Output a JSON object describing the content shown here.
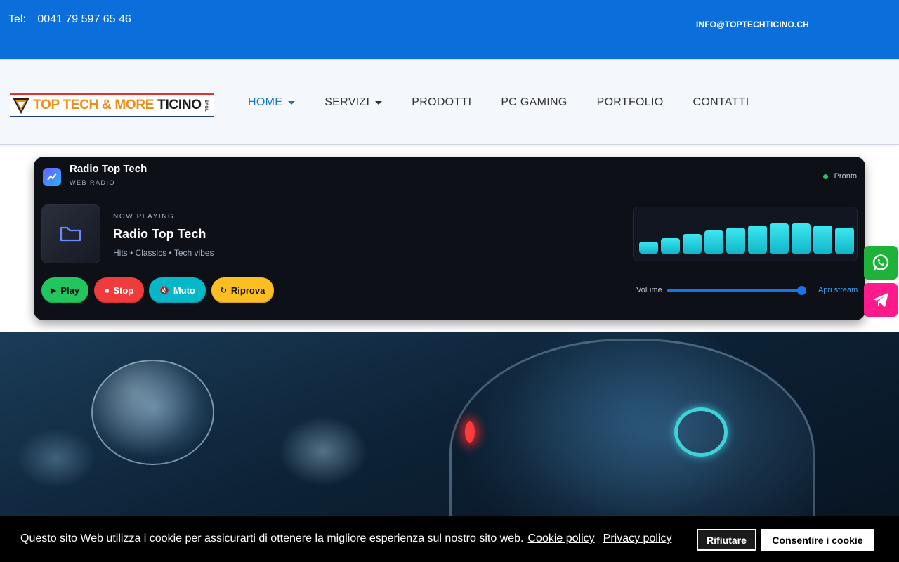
{
  "topbar": {
    "tel_label": "Tel:",
    "tel_number": "0041 79 597 65 46",
    "email": "INFO@TOPTECHTICINO.CH",
    "bg_color": "#0a6fdb"
  },
  "logo": {
    "part1": "TOP TECH & ",
    "part2": "MORE",
    "part3": " TICINO",
    "suffix": "SAGL"
  },
  "nav": {
    "items": [
      {
        "label": "HOME",
        "dropdown": true,
        "active": true
      },
      {
        "label": "SERVIZI",
        "dropdown": true,
        "active": false
      },
      {
        "label": "PRODOTTI",
        "dropdown": false,
        "active": false
      },
      {
        "label": "PC GAMING",
        "dropdown": false,
        "active": false
      },
      {
        "label": "PORTFOLIO",
        "dropdown": false,
        "active": false
      },
      {
        "label": "CONTATTI",
        "dropdown": false,
        "active": false
      }
    ]
  },
  "radio": {
    "title": "Radio Top Tech",
    "subtitle": "WEB RADIO",
    "status": "Pronto",
    "now_playing_label": "NOW PLAYING",
    "now_playing_title": "Radio Top Tech",
    "now_playing_desc": "Hits • Classics • Tech vibes",
    "visualizer_levels": [
      0.25,
      0.35,
      0.47,
      0.58,
      0.65,
      0.72,
      0.77,
      0.77,
      0.72,
      0.65
    ],
    "buttons": {
      "play": "Play",
      "stop": "Stop",
      "mute": "Muto",
      "retry": "Riprova"
    },
    "volume_label": "Volume",
    "volume_level": 1.0,
    "open_stream": "Apri stream"
  },
  "social": {
    "whatsapp_icon": "whatsapp-icon",
    "telegram_icon": "telegram-icon"
  },
  "cookie": {
    "message": "Questo sito Web utilizza i cookie per assicurarti di ottenere la migliore esperienza sul nostro sito web.",
    "cookie_policy": "Cookie policy",
    "privacy_policy": "Privacy policy",
    "reject": "Rifiutare",
    "accept": "Consentire i cookie"
  }
}
